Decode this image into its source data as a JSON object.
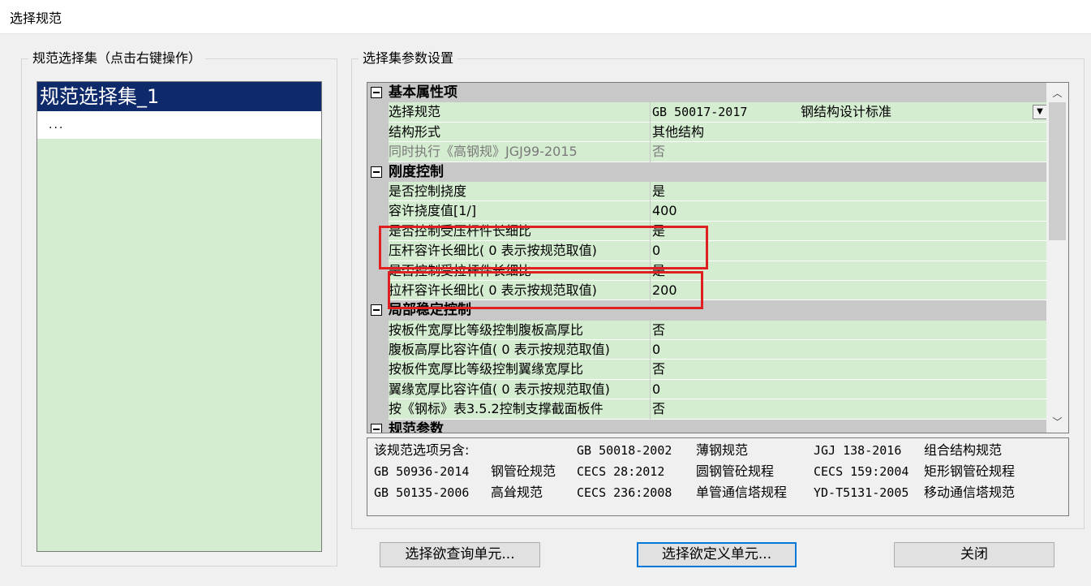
{
  "window": {
    "title": "选择规范"
  },
  "left_panel": {
    "legend": "规范选择集（点击右键操作）",
    "items": [
      "规范选择集_1",
      "..."
    ]
  },
  "right_panel": {
    "legend": "选择集参数设置",
    "categories": [
      {
        "label": "基本属性项",
        "rows": [
          {
            "name": "选择规范",
            "value": "GB 50017-2017",
            "value2": "钢结构设计标准",
            "combo": true
          },
          {
            "name": "结构形式",
            "value": "其他结构"
          },
          {
            "name": "同时执行《高钢规》JGJ99-2015",
            "value": "否",
            "disabled": true
          }
        ]
      },
      {
        "label": "刚度控制",
        "rows": [
          {
            "name": "是否控制挠度",
            "value": "是"
          },
          {
            "name": "容许挠度值[1/]",
            "value": "400"
          },
          {
            "name": "是否控制受压杆件长细比",
            "value": "是"
          },
          {
            "name": "压杆容许长细比( 0 表示按规范取值)",
            "value": "0"
          },
          {
            "name": "是否控制受拉杆件长细比",
            "value": "是"
          },
          {
            "name": "拉杆容许长细比( 0 表示按规范取值)",
            "value": "200"
          }
        ]
      },
      {
        "label": "局部稳定控制",
        "rows": [
          {
            "name": "按板件宽厚比等级控制腹板高厚比",
            "value": "否"
          },
          {
            "name": "腹板高厚比容许值( 0 表示按规范取值)",
            "value": "0"
          },
          {
            "name": "按板件宽厚比等级控制翼缘宽厚比",
            "value": "否"
          },
          {
            "name": "翼缘宽厚比容许值( 0 表示按规范取值)",
            "value": "0"
          },
          {
            "name": "按《钢标》表3.5.2控制支撑截面板件",
            "value": "否"
          }
        ]
      },
      {
        "label": "规范参数",
        "rows": []
      }
    ]
  },
  "info": {
    "heading": "该规范选项另含:",
    "entries": [
      {
        "code": "GB 50018-2002",
        "name": "薄钢规范"
      },
      {
        "code": "JGJ 138-2016",
        "name": "组合结构规范"
      },
      {
        "code": "GB 50936-2014",
        "name": "钢管砼规范"
      },
      {
        "code": "CECS 28:2012",
        "name": "圆钢管砼规程"
      },
      {
        "code": "CECS 159:2004",
        "name": "矩形钢管砼规程"
      },
      {
        "code": "GB 50135-2006",
        "name": "高耸规范"
      },
      {
        "code": "CECS 236:2008",
        "name": "单管通信塔规程"
      },
      {
        "code": "YD-T5131-2005",
        "name": "移动通信塔规范"
      }
    ]
  },
  "buttons": {
    "query": "选择欲查询单元...",
    "define": "选择欲定义单元...",
    "close": "关闭"
  },
  "colors": {
    "grid_row": "#d4ecd0",
    "category": "#c8c8c8",
    "selection": "#0f2a6b",
    "highlight": "#e02020",
    "default_button_border": "#0078d7"
  }
}
